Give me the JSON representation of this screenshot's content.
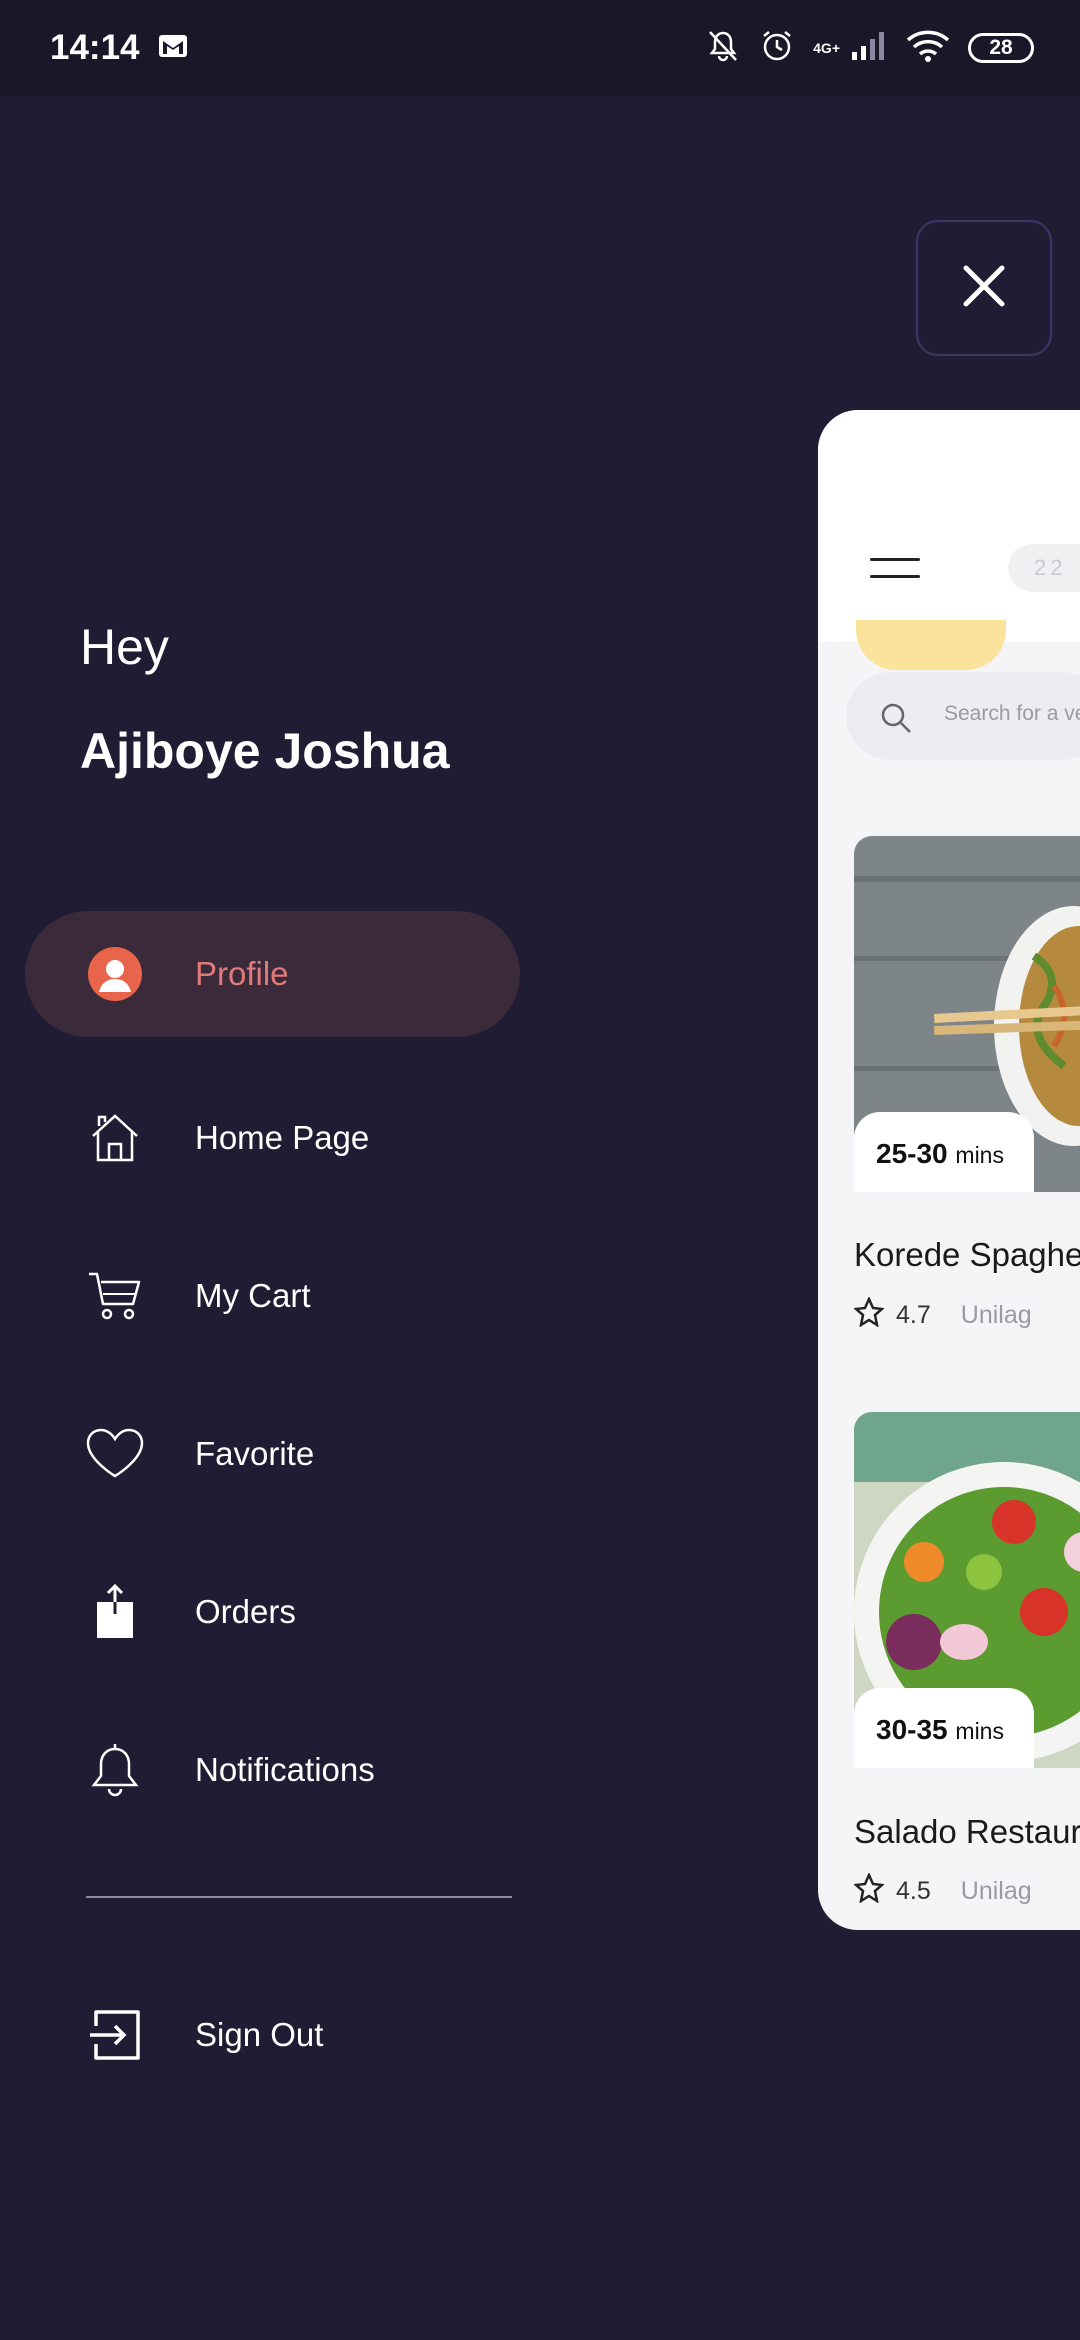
{
  "status_bar": {
    "time": "14:14",
    "network": "4G+",
    "battery": "28"
  },
  "greeting": {
    "hey": "Hey",
    "name": "Ajiboye Joshua"
  },
  "menu": {
    "items": [
      {
        "label": "Profile",
        "icon": "profile-icon",
        "active": true
      },
      {
        "label": "Home Page",
        "icon": "home-icon"
      },
      {
        "label": "My Cart",
        "icon": "cart-icon"
      },
      {
        "label": "Favorite",
        "icon": "heart-icon"
      },
      {
        "label": "Orders",
        "icon": "share-icon"
      },
      {
        "label": "Notifications",
        "icon": "bell-icon"
      }
    ],
    "sign_out": "Sign Out"
  },
  "preview": {
    "header_pill": "22",
    "search_placeholder": "Search for a ve",
    "foods": [
      {
        "time": "25-30",
        "unit": "mins",
        "title": "Korede Spaghe",
        "rating": "4.7",
        "location": "Unilag"
      },
      {
        "time": "30-35",
        "unit": "mins",
        "title": "Salado Restaur",
        "rating": "4.5",
        "location": "Unilag"
      }
    ]
  },
  "colors": {
    "background": "#201c33",
    "accent": "#e07a7a",
    "active_bg": "#3a2a3a",
    "profile_icon": "#e8644a"
  }
}
